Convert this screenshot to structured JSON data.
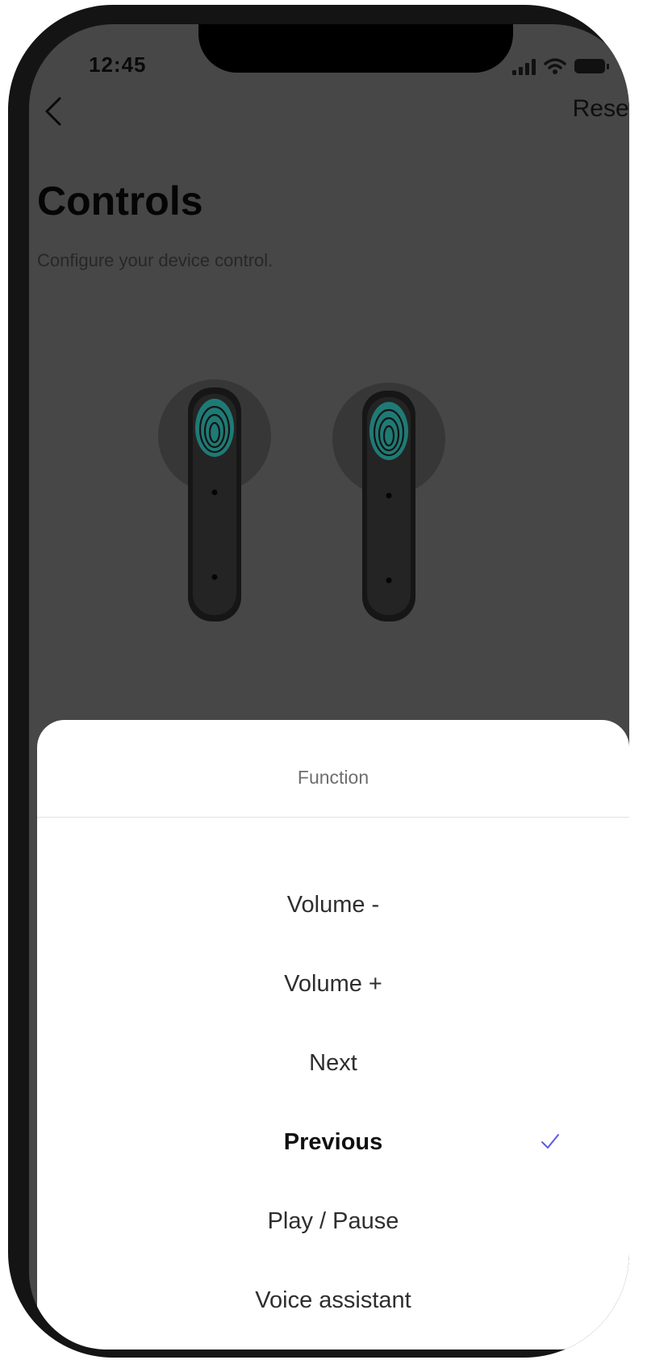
{
  "status_bar": {
    "time": "12:45"
  },
  "header": {
    "back_icon": "chevron-left-icon",
    "reset_label": "Reset"
  },
  "page": {
    "title": "Controls",
    "subtitle": "Configure your device control."
  },
  "sheet": {
    "title": "Function",
    "options": [
      {
        "label": "Volume -",
        "selected": false
      },
      {
        "label": "Volume +",
        "selected": false
      },
      {
        "label": "Next",
        "selected": false
      },
      {
        "label": "Previous",
        "selected": true
      },
      {
        "label": "Play / Pause",
        "selected": false
      },
      {
        "label": "Voice assistant",
        "selected": false
      }
    ],
    "check_icon": "checkmark-icon",
    "check_color": "#5a5ae6"
  },
  "colors": {
    "overlay_background": "#474747",
    "sheet_background": "#ffffff",
    "fingerprint_accent": "#1f8a84"
  }
}
